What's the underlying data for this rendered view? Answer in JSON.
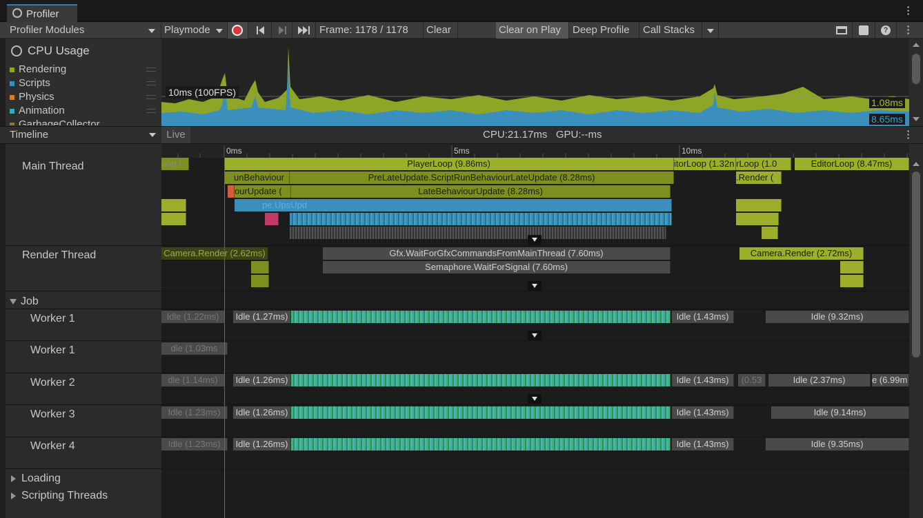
{
  "window": {
    "tab_title": "Profiler",
    "menu_icon": "kebab-menu-icon"
  },
  "toolbar": {
    "modules_dropdown": "Profiler Modules",
    "playmode_dropdown": "Playmode",
    "frame_label": "Frame: 1178 / 1178",
    "clear": "Clear",
    "clear_on_play": "Clear on Play",
    "deep_profile": "Deep Profile",
    "call_stacks": "Call Stacks"
  },
  "cpu_module": {
    "title": "CPU Usage",
    "legend": [
      {
        "label": "Rendering",
        "color": "#8da625"
      },
      {
        "label": "Scripts",
        "color": "#3a8fbc"
      },
      {
        "label": "Physics",
        "color": "#d37e2b"
      },
      {
        "label": "Animation",
        "color": "#3aa7bc"
      },
      {
        "label": "GarbageCollector",
        "color": "#8a7a2b"
      }
    ],
    "threshold_label": "10ms (100FPS)",
    "value_top": "1.08ms",
    "value_bottom": "8.65ms"
  },
  "timeline_header": {
    "view_dropdown": "Timeline",
    "live": "Live",
    "stats": "CPU:21.17ms   GPU:--ms"
  },
  "ruler": {
    "ticks": [
      "0ms",
      "5ms",
      "10ms"
    ]
  },
  "threads": {
    "main": "Main Thread",
    "render": "Render Thread",
    "job_group": "Job",
    "workers": [
      "Worker 1",
      "Worker 1",
      "Worker 2",
      "Worker 3",
      "Worker 4"
    ],
    "loading": "Loading",
    "scripting": "Scripting Threads"
  },
  "markers": {
    "loop_clip": "oop (",
    "player_loop": "PlayerLoop (9.86ms)",
    "editor_loop_a": "itorLoop (1.32n",
    "editor_loop_b": "rLoop (1.0",
    "editor_loop_c": "EditorLoop (8.47ms)",
    "run_behaviour": "unBehaviour",
    "pre_late_update": "PreLateUpdate.ScriptRunBehaviourLateUpdate (8.28ms)",
    "render_clip": ".Render (",
    "our_update": "ourUpdate (",
    "late_behaviour_update": "LateBehaviourUpdate (8.28ms)",
    "ups_update": "pe.UpsUpd",
    "cam_render_a": "Camera.Render (2.62ms)",
    "gfx_wait": "Gfx.WaitForGfxCommandsFromMainThread (7.60ms)",
    "semaphore_wait": "Semaphore.WaitForSignal (7.60ms)",
    "cam_render_b": "Camera.Render (2.72ms)",
    "w1_idle_a": "Idle (1.22ms)",
    "w1_idle_b": "Idle (1.27ms)",
    "w1_idle_c": "Idle (1.43ms)",
    "w1_idle_d": "Idle (9.32ms)",
    "w1b_idle": "dle (1.03ms",
    "w2_idle_a": "dle (1.14ms)",
    "w2_idle_b": "Idle (1.26ms)",
    "w2_idle_c": "Idle (1.43ms)",
    "w2_idle_d": "(0.53",
    "w2_idle_e": "Idle (2.37ms)",
    "w2_idle_f": "e (6.99m",
    "w3_idle_a": "Idle (1.23ms)",
    "w3_idle_b": "Idle (1.26ms)",
    "w3_idle_c": "Idle (1.43ms)",
    "w3_idle_d": "Idle (9.14ms)",
    "w4_idle_a": "Idle (1.23ms)",
    "w4_idle_b": "Idle (1.26ms)",
    "w4_idle_c": "Idle (1.43ms)",
    "w4_idle_d": "Idle (9.35ms)"
  }
}
